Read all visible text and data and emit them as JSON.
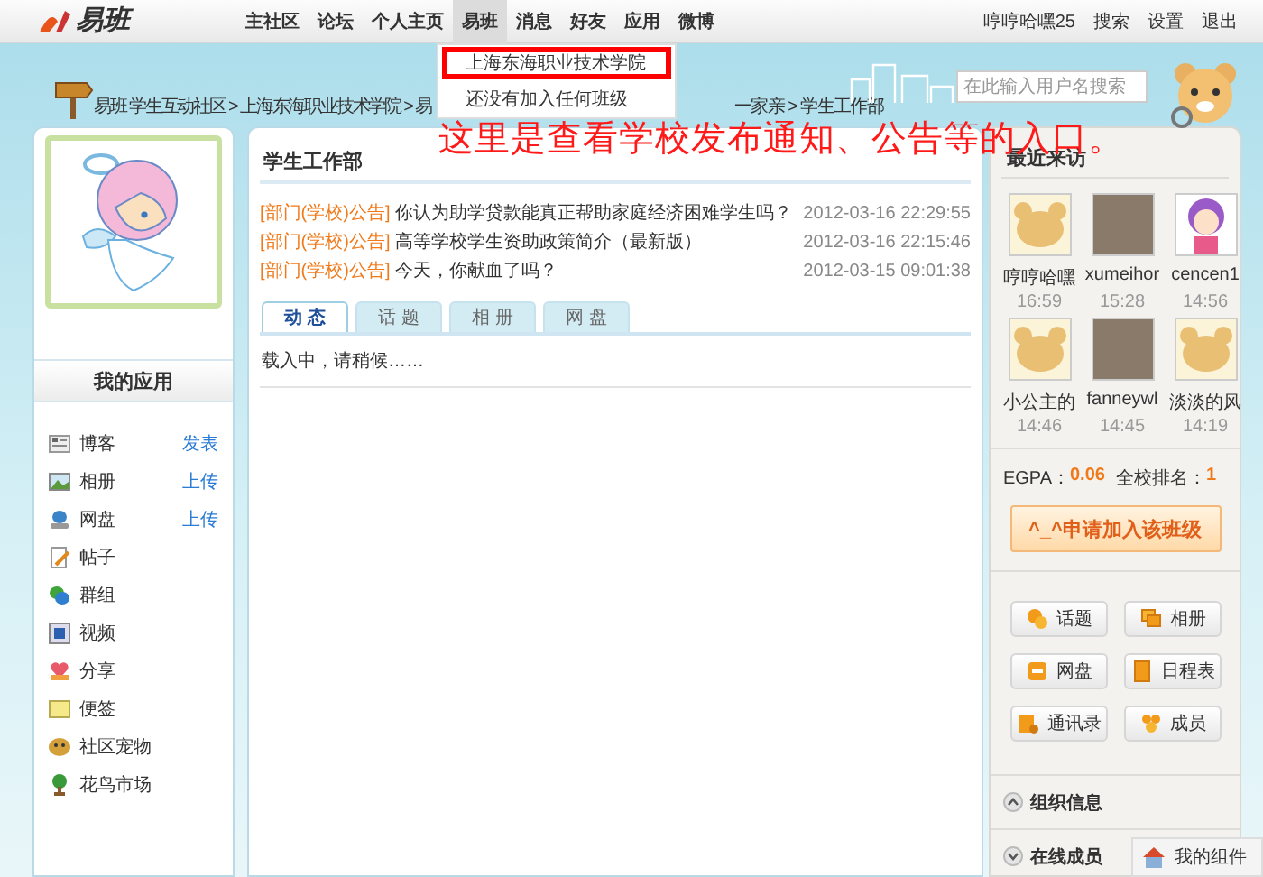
{
  "top_nav": {
    "logo": "易班",
    "items": [
      {
        "label": "主社区",
        "selected": false
      },
      {
        "label": "论坛",
        "selected": false
      },
      {
        "label": "个人主页",
        "selected": false
      },
      {
        "label": "易班",
        "selected": true
      },
      {
        "label": "消息",
        "selected": false
      },
      {
        "label": "好友",
        "selected": false
      },
      {
        "label": "应用",
        "selected": false
      },
      {
        "label": "微博",
        "selected": false
      }
    ],
    "user": "哼哼哈嘿25",
    "links": [
      "搜索",
      "设置",
      "退出"
    ]
  },
  "breadcrumb": [
    "易班 学生互动社区 > 上海东海职业技术学院 > 易",
    "一家亲 > 学生工作部"
  ],
  "search": {
    "placeholder": "在此输入用户名搜索"
  },
  "class_dropdown": {
    "items": [
      {
        "label": "上海东海职业技术学院",
        "highlighted": true
      },
      {
        "label": "还没有加入任何班级",
        "highlighted": false
      }
    ]
  },
  "annotation": "这里是查看学校发布通知、公告等的入口。",
  "my_apps": {
    "title": "我的应用",
    "items": [
      {
        "label": "博客",
        "action": "发表"
      },
      {
        "label": "相册",
        "action": "上传"
      },
      {
        "label": "网盘",
        "action": "上传"
      },
      {
        "label": "帖子"
      },
      {
        "label": "群组"
      },
      {
        "label": "视频"
      },
      {
        "label": "分享"
      },
      {
        "label": "便签"
      },
      {
        "label": "社区宠物"
      },
      {
        "label": "花鸟市场"
      }
    ]
  },
  "department": {
    "title": "学生工作部",
    "notices": [
      {
        "tag": "[部门(学校)公告]",
        "title": "你认为助学贷款能真正帮助家庭经济困难学生吗？",
        "time": "2012-03-16 22:29:55"
      },
      {
        "tag": "[部门(学校)公告]",
        "title": "高等学校学生资助政策简介（最新版）",
        "time": "2012-03-16 22:15:46"
      },
      {
        "tag": "[部门(学校)公告]",
        "title": "今天，你献血了吗？",
        "time": "2012-03-15 09:01:38"
      }
    ],
    "tabs": [
      {
        "label": "动 态",
        "selected": true
      },
      {
        "label": "话 题",
        "selected": false
      },
      {
        "label": "相 册",
        "selected": false
      },
      {
        "label": "网 盘",
        "selected": false
      }
    ],
    "loading": "载入中，请稍候……"
  },
  "recent_visitors": {
    "title": "最近来访",
    "items": [
      {
        "name": "哼哼哈嘿",
        "time": "16:59",
        "kind": "default"
      },
      {
        "name": "xumeihor",
        "time": "15:28",
        "kind": "photo"
      },
      {
        "name": "cencen1",
        "time": "14:56",
        "kind": "cartoon"
      },
      {
        "name": "小公主的",
        "time": "14:46",
        "kind": "default"
      },
      {
        "name": "fanneywl",
        "time": "14:45",
        "kind": "photo"
      },
      {
        "name": "淡淡的风",
        "time": "14:19",
        "kind": "default"
      }
    ]
  },
  "stats": {
    "egpa_label": "EGPA：",
    "egpa_value": "0.06",
    "rank_label": "全校排名：",
    "rank_value": "1"
  },
  "join_button": "^_^申请加入该班级",
  "group_buttons": [
    "话题",
    "相册",
    "网盘",
    "日程表",
    "通讯录",
    "成员"
  ],
  "sections": [
    {
      "label": "组织信息",
      "expanded": true
    },
    {
      "label": "在线成员",
      "expanded": false
    }
  ],
  "widget": "我的组件"
}
